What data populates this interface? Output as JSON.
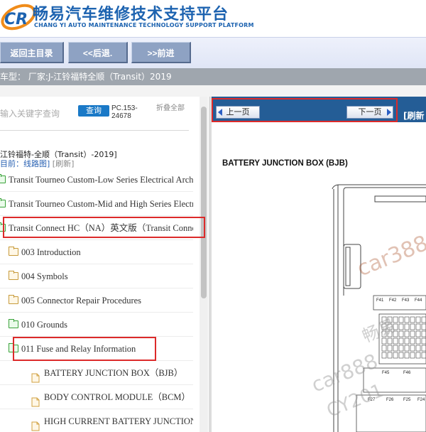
{
  "header": {
    "title": "畅易汽车维修技术支持平台",
    "subtitle": "CHANG YI AUTO MAINTENANCE TECHNOLOGY SUPPORT PLATFORM",
    "logo_letters": "CR"
  },
  "toolbar": {
    "home_label": "返回主目录",
    "back_label": "<<后退.",
    "forward_label": ">>前进"
  },
  "model": {
    "text": "车型：  厂家:J-江铃福特全顺（Transit）2019"
  },
  "search": {
    "placeholder": "输入关键字查询",
    "button_label": "查询",
    "code": "PC.153-24678",
    "collapse_label": "折叠全部"
  },
  "tree": {
    "root_label": "江铃福特-全顺（Transit）-2019]",
    "path_label": "目前：线路图]",
    "refresh_label": "[刷新]",
    "items": [
      {
        "label": "Transit Tourneo Custom-Low Series Electrical Architecture",
        "icon": "folder-green-icon"
      },
      {
        "label": "Transit Tourneo Custom-Mid and High Series Electrical",
        "icon": "folder-green-icon"
      },
      {
        "label": "Transit Connect HC（NA）英文版（Transit Connect）",
        "icon": "folder-green-icon"
      },
      {
        "label": "003 Introduction",
        "icon": "folder-icon"
      },
      {
        "label": "004 Symbols",
        "icon": "folder-icon"
      },
      {
        "label": "005 Connector Repair Procedures",
        "icon": "folder-icon"
      },
      {
        "label": "010 Grounds",
        "icon": "folder-green-icon"
      },
      {
        "label": "011 Fuse and Relay Information",
        "icon": "folder-open-icon"
      },
      {
        "label": "BATTERY JUNCTION BOX（BJB）",
        "icon": "page-icon"
      },
      {
        "label": "BODY CONTROL MODULE（BCM）",
        "icon": "page-icon"
      },
      {
        "label": "HIGH CURRENT BATTERY JUNCTION BOX",
        "icon": "page-icon"
      }
    ]
  },
  "viewer": {
    "prev_label": "上一页",
    "next_label": "下一页",
    "refresh_label": "[刷新",
    "doc_title": "BATTERY JUNCTION BOX (BJB)",
    "fuse_labels": [
      "F41",
      "F42",
      "F43",
      "F44",
      "F45",
      "F46",
      "F27",
      "F26",
      "F25",
      "F24"
    ]
  },
  "watermarks": [
    "car388",
    "畅易",
    "car888",
    "CY201"
  ],
  "colors": {
    "brand_blue": "#1d63b0",
    "nav_blue": "#245d96",
    "highlight_red": "#dc2a2a",
    "toolbar_button": "#8ea2c3"
  }
}
